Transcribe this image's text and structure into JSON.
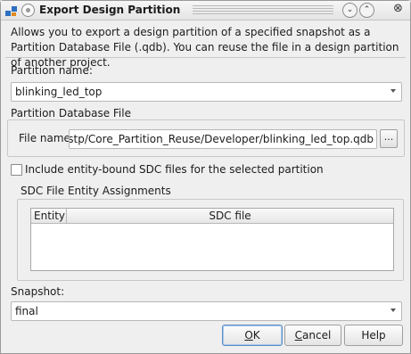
{
  "window": {
    "title": "Export Design Partition"
  },
  "description": "Allows you to export a design partition of a specified snapshot as a Partition Database File (.qdb). You can reuse the file in a design partition of another project.",
  "partition": {
    "label": "Partition name:",
    "value": "blinking_led_top"
  },
  "database": {
    "group_label": "Partition Database File",
    "file_label": "File name:",
    "file_value": "k_reuse_stp/Core_Partition_Reuse/Developer/blinking_led_top.qdb",
    "browse_label": "..."
  },
  "sdc": {
    "checkbox_label": "Include entity-bound SDC files for the selected partition",
    "checked": false,
    "assignments_label": "SDC File Entity Assignments",
    "columns": [
      "Entity",
      "SDC file"
    ],
    "rows": []
  },
  "snapshot": {
    "label": "Snapshot:",
    "value": "final"
  },
  "buttons": {
    "ok_mnemonic": "O",
    "ok_rest": "K",
    "cancel_mnemonic": "C",
    "cancel_rest": "ancel",
    "help": "Help"
  },
  "icons": {
    "app": "quartus-app-icon",
    "min": "chevron-down-icon",
    "max": "chevron-up-icon",
    "close": "close-icon"
  }
}
